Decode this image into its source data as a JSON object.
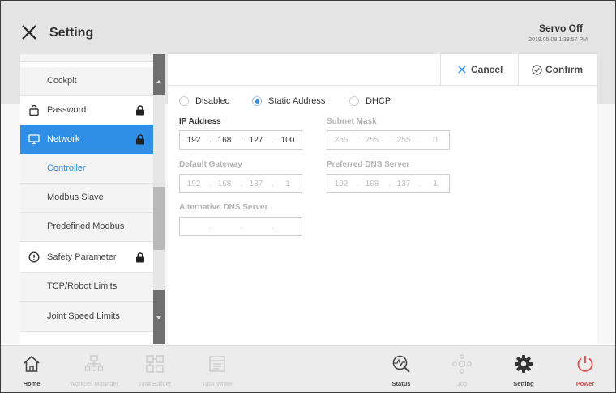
{
  "header": {
    "title": "Setting",
    "servo_status": "Servo Off",
    "datetime": "2019.05.08 1:33:57 PM"
  },
  "sidebar": {
    "items": [
      {
        "label": "Cockpit"
      },
      {
        "label": "Password"
      },
      {
        "label": "Network"
      },
      {
        "label": "Controller"
      },
      {
        "label": "Modbus Slave"
      },
      {
        "label": "Predefined Modbus"
      },
      {
        "label": "Safety Parameter"
      },
      {
        "label": "TCP/Robot Limits"
      },
      {
        "label": "Joint Speed Limits"
      }
    ]
  },
  "actions": {
    "cancel_label": "Cancel",
    "confirm_label": "Confirm"
  },
  "network": {
    "mode_options": [
      "Disabled",
      "Static Address",
      "DHCP"
    ],
    "selected_mode": "Static Address",
    "ip_address": {
      "label": "IP Address",
      "octets": [
        "192",
        "168",
        "127",
        "100"
      ]
    },
    "subnet_mask": {
      "label": "Subnet Mask",
      "octets": [
        "255",
        "255",
        "255",
        "0"
      ]
    },
    "default_gateway": {
      "label": "Default Gateway",
      "octets": [
        "192",
        "168",
        "137",
        "1"
      ]
    },
    "preferred_dns": {
      "label": "Preferred DNS Server",
      "octets": [
        "192",
        "168",
        "137",
        "1"
      ]
    },
    "alternative_dns": {
      "label": "Alternative DNS Server",
      "octets": [
        "",
        "",
        "",
        ""
      ]
    }
  },
  "bottom_nav": {
    "home": "Home",
    "workcell_manager": "Workcell Manager",
    "task_builder": "Task Builder",
    "task_writer": "Task Writer",
    "status": "Status",
    "jog": "Jog",
    "setting": "Setting",
    "power": "Power"
  },
  "colors": {
    "accent": "#2f8ee6",
    "power": "#e24b4b"
  }
}
